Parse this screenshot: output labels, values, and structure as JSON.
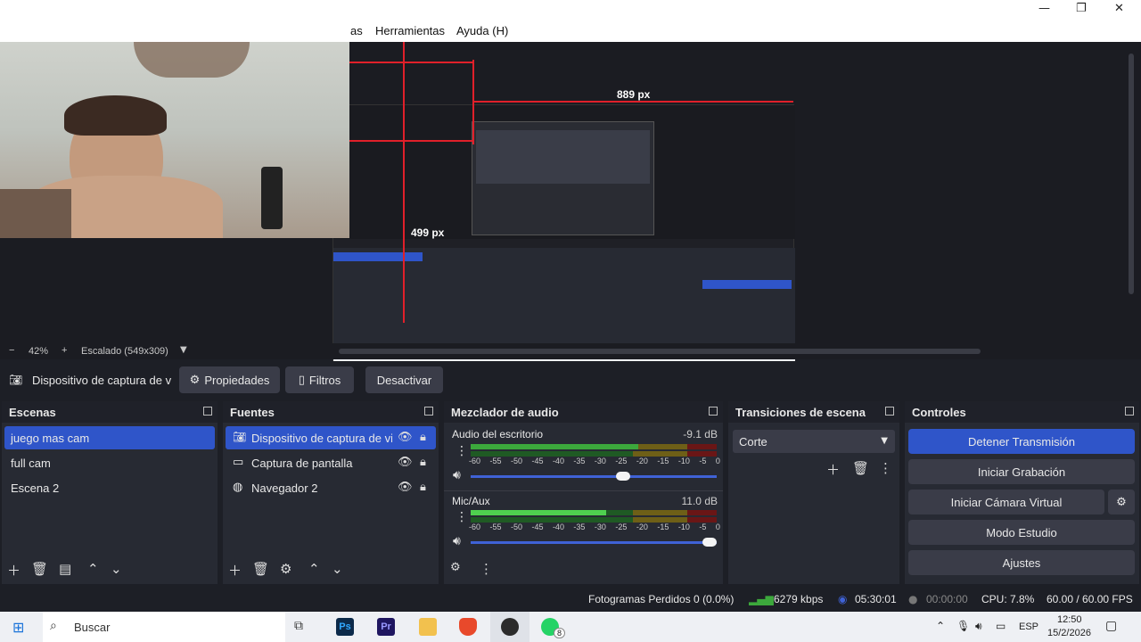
{
  "window": {
    "min_glyph": "—",
    "restore_glyph": "❐",
    "close_glyph": "✕"
  },
  "menu": {
    "items": [
      "as",
      "Herramientas",
      "Ayuda (H)"
    ]
  },
  "preview": {
    "measure_horizontal": "889 px",
    "measure_vertical": "499 px"
  },
  "zoombar": {
    "minus": "−",
    "zoom": "42%",
    "plus": "+",
    "scale_label": "Escalado (549x309)"
  },
  "source_toolbar": {
    "source_name": "Dispositivo de captura de v",
    "properties": "Propiedades",
    "filters": "Filtros",
    "deactivate": "Desactivar"
  },
  "scenes": {
    "title": "Escenas",
    "items": [
      {
        "label": "juego mas cam",
        "selected": true
      },
      {
        "label": "full cam",
        "selected": false
      },
      {
        "label": "Escena 2",
        "selected": false
      }
    ]
  },
  "sources": {
    "title": "Fuentes",
    "items": [
      {
        "label": "Dispositivo de captura de vic",
        "icon": "camera-icon",
        "selected": true
      },
      {
        "label": "Captura de pantalla",
        "icon": "monitor-icon",
        "selected": false
      },
      {
        "label": "Navegador 2",
        "icon": "globe-icon",
        "selected": false
      }
    ]
  },
  "mixer": {
    "title": "Mezclador de audio",
    "channels": [
      {
        "name": "Audio del escritorio",
        "db": "-9.1 dB",
        "level_fraction": 0.68,
        "volume_fraction": 0.65
      },
      {
        "name": "Mic/Aux",
        "db": "11.0 dB",
        "level_fraction": 0.55,
        "volume_fraction": 1.0
      }
    ],
    "scale": [
      "-60",
      "-55",
      "-50",
      "-45",
      "-40",
      "-35",
      "-30",
      "-25",
      "-20",
      "-15",
      "-10",
      "-5",
      "0"
    ]
  },
  "transitions": {
    "title": "Transiciones de escena",
    "selected": "Corte"
  },
  "controls": {
    "title": "Controles",
    "stop_stream": "Detener Transmisión",
    "start_recording": "Iniciar Grabación",
    "start_virtual_cam": "Iniciar Cámara Virtual",
    "studio_mode": "Modo Estudio",
    "settings": "Ajustes"
  },
  "status": {
    "dropped_frames": "Fotogramas Perdidos 0 (0.0%)",
    "bitrate": "6279 kbps",
    "stream_time": "05:30:01",
    "record_time": "00:00:00",
    "cpu": "CPU: 7.8%",
    "fps": "60.00 / 60.00 FPS"
  },
  "taskbar": {
    "search_placeholder": "Buscar",
    "language": "ESP",
    "time": "12:50",
    "date": "15/2/2026",
    "whatsapp_badge": "8",
    "apps": [
      {
        "name": "task-view",
        "label": ""
      },
      {
        "name": "photoshop",
        "label": "Ps",
        "color": "#0c2a4a"
      },
      {
        "name": "premiere",
        "label": "Pr",
        "color": "#1f1660"
      },
      {
        "name": "file-explorer",
        "label": "",
        "color": "#f2c14e"
      },
      {
        "name": "brave",
        "label": "",
        "color": "#e8492b"
      },
      {
        "name": "obs",
        "label": "",
        "color": "#2b2b2b"
      },
      {
        "name": "whatsapp",
        "label": "",
        "color": "#25d366"
      }
    ]
  },
  "colors": {
    "accent": "#2f55c9",
    "dock_bg": "#272a33",
    "meter_green": "#3ca83c",
    "meter_yellow": "#b8a12a",
    "meter_red": "#b42424",
    "measure_red": "#e0202a"
  }
}
